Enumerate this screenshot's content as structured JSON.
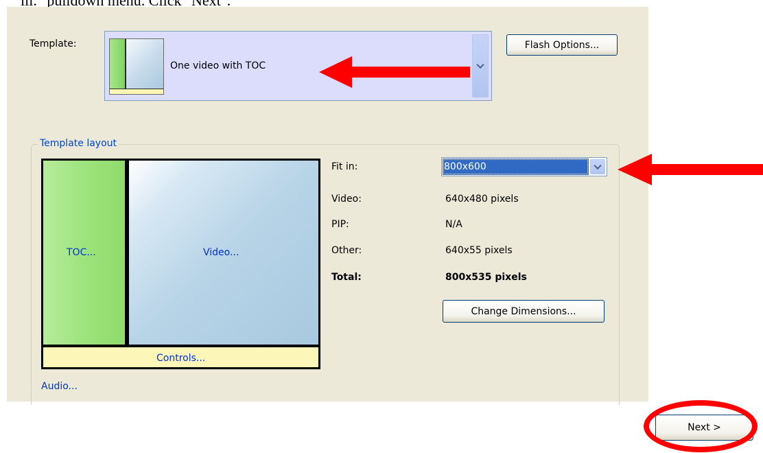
{
  "instruction_line": "iii. \"pulldown menu. Click \"Next\".",
  "template": {
    "label": "Template:",
    "selected": "One video with TOC"
  },
  "flash_options_button": "Flash Options...",
  "template_layout": {
    "title": "Template layout",
    "preview": {
      "toc": "TOC...",
      "video": "Video...",
      "controls": "Controls..."
    },
    "audio_link": "Audio..."
  },
  "dimensions": {
    "fit_in_label": "Fit in:",
    "fit_in_value": "800x600",
    "video_label": "Video:",
    "video_value": "640x480 pixels",
    "pip_label": "PIP:",
    "pip_value": "N/A",
    "other_label": "Other:",
    "other_value": "640x55 pixels",
    "total_label": "Total:",
    "total_value": "800x535 pixels"
  },
  "change_dimensions_button": "Change Dimensions...",
  "next_button": "Next >",
  "annotation_color": "#ff0000"
}
